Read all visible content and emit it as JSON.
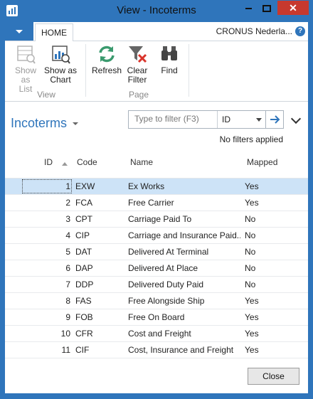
{
  "window": {
    "title": "View - Incoterms"
  },
  "ribbon": {
    "tab_home": "HOME",
    "company": "CRONUS Nederla...",
    "help": "?",
    "show_as_list": [
      "Show",
      "as List"
    ],
    "show_as_chart": [
      "Show as",
      "Chart"
    ],
    "refresh": "Refresh",
    "clear_filter": [
      "Clear",
      "Filter"
    ],
    "find": "Find",
    "group_view": "View",
    "group_page": "Page"
  },
  "page": {
    "title": "Incoterms",
    "filter_placeholder": "Type to filter (F3)",
    "filter_field": "ID",
    "no_filters": "No filters applied"
  },
  "table": {
    "columns": [
      "ID",
      "Code",
      "Name",
      "Mapped"
    ],
    "rows": [
      {
        "id": "1",
        "code": "EXW",
        "name": "Ex Works",
        "mapped": "Yes"
      },
      {
        "id": "2",
        "code": "FCA",
        "name": "Free Carrier",
        "mapped": "Yes"
      },
      {
        "id": "3",
        "code": "CPT",
        "name": "Carriage Paid To",
        "mapped": "No"
      },
      {
        "id": "4",
        "code": "CIP",
        "name": "Carriage and Insurance Paid...",
        "mapped": "No"
      },
      {
        "id": "5",
        "code": "DAT",
        "name": "Delivered At Terminal",
        "mapped": "No"
      },
      {
        "id": "6",
        "code": "DAP",
        "name": "Delivered At Place",
        "mapped": "No"
      },
      {
        "id": "7",
        "code": "DDP",
        "name": "Delivered Duty Paid",
        "mapped": "No"
      },
      {
        "id": "8",
        "code": "FAS",
        "name": "Free Alongside Ship",
        "mapped": "Yes"
      },
      {
        "id": "9",
        "code": "FOB",
        "name": "Free On Board",
        "mapped": "Yes"
      },
      {
        "id": "10",
        "code": "CFR",
        "name": "Cost and Freight",
        "mapped": "Yes"
      },
      {
        "id": "11",
        "code": "CIF",
        "name": "Cost, Insurance and Freight",
        "mapped": "Yes"
      }
    ]
  },
  "footer": {
    "close": "Close"
  },
  "colors": {
    "accent": "#2f75bb",
    "selected_row": "#cde3f7",
    "close_btn": "#c7392e"
  }
}
